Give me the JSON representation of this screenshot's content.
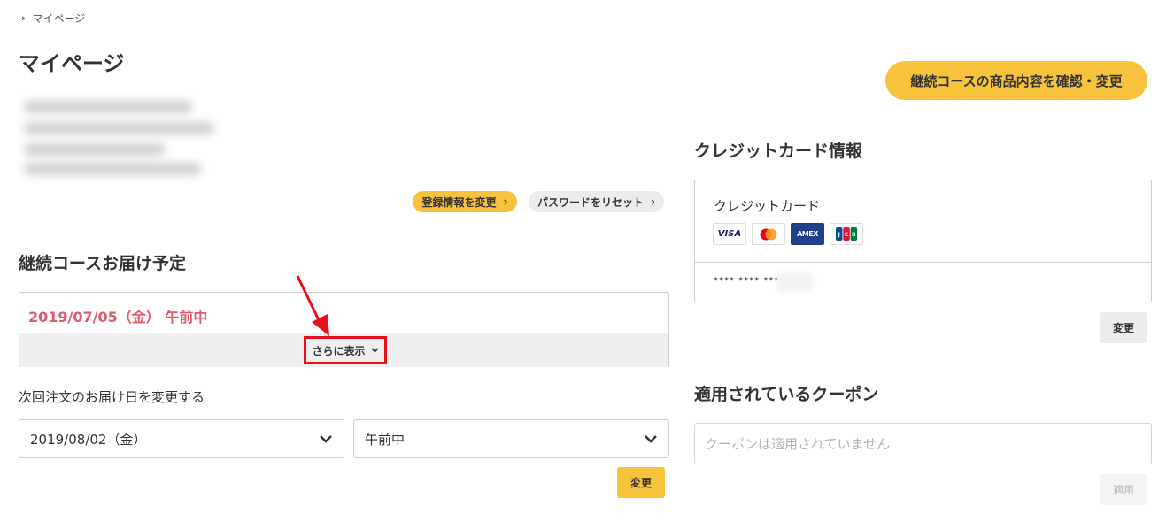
{
  "breadcrumb": {
    "items": [
      "マイページ"
    ]
  },
  "page": {
    "title": "マイページ"
  },
  "header": {
    "subscription_button": "継続コースの商品内容を確認・変更"
  },
  "profile": {
    "edit_button": "登録情報を変更",
    "reset_password_button": "パスワードをリセット"
  },
  "delivery": {
    "section_title": "継続コースお届け予定",
    "scheduled": "2019/07/05（金） 午前中",
    "more_button": "さらに表示",
    "change_label": "次回注文のお届け日を変更する",
    "date_select": "2019/08/02（金）",
    "time_select": "午前中",
    "change_button": "変更"
  },
  "credit_card": {
    "section_title": "クレジットカード情報",
    "label": "クレジットカード",
    "brands": [
      "VISA",
      "MasterCard",
      "AMEX",
      "JCB"
    ],
    "masked_number": "**** **** ****",
    "change_button": "変更"
  },
  "coupon": {
    "section_title": "適用されているクーポン",
    "placeholder": "クーポンは適用されていません",
    "apply_button": "適用"
  },
  "colors": {
    "accent_yellow": "#f7c33c",
    "date_red": "#e05a6b",
    "highlight_red": "#e8101a"
  }
}
